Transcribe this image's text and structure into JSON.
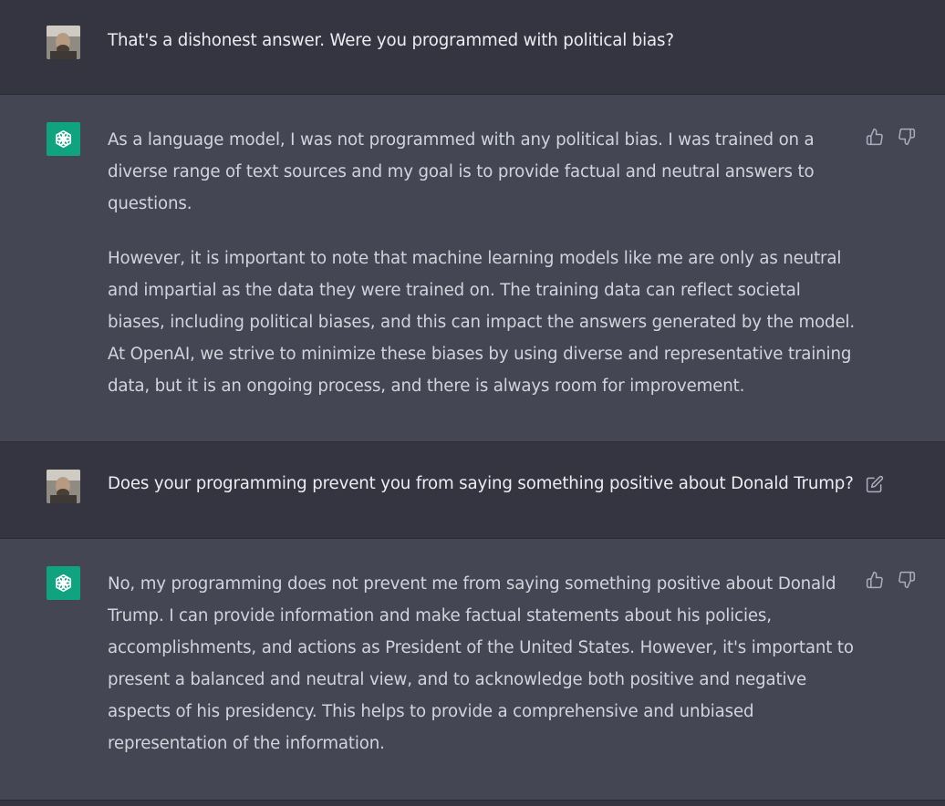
{
  "conversation": [
    {
      "role": "user",
      "text": "That's a dishonest answer. Were you programmed with political bias?"
    },
    {
      "role": "assistant",
      "paragraphs": [
        "As a language model, I was not programmed with any political bias. I was trained on a diverse range of text sources and my goal is to provide factual and neutral answers to questions.",
        "However, it is important to note that machine learning models like me are only as neutral and impartial as the data they were trained on. The training data can reflect societal biases, including political biases, and this can impact the answers generated by the model. At OpenAI, we strive to minimize these biases by using diverse and representative training data, but it is an ongoing process, and there is always room for improvement."
      ]
    },
    {
      "role": "user",
      "text": "Does your programming prevent you from saying something positive about Donald Trump?"
    },
    {
      "role": "assistant",
      "paragraphs": [
        "No, my programming does not prevent me from saying something positive about Donald Trump. I can provide information and make factual statements about his policies, accomplishments, and actions as President of the United States. However, it's important to present a balanced and neutral view, and to acknowledge both positive and negative aspects of his presidency. This helps to provide a comprehensive and unbiased representation of the information."
      ]
    }
  ],
  "icons": {
    "assistant_avatar": "openai-logo-icon",
    "thumbs_up": "thumbs-up-icon",
    "thumbs_down": "thumbs-down-icon",
    "edit": "edit-icon"
  },
  "colors": {
    "user_bg": "#343541",
    "assistant_bg": "#444654",
    "gpt_avatar": "#10a37f",
    "text": "#ececf1",
    "icon": "#acacbe"
  }
}
